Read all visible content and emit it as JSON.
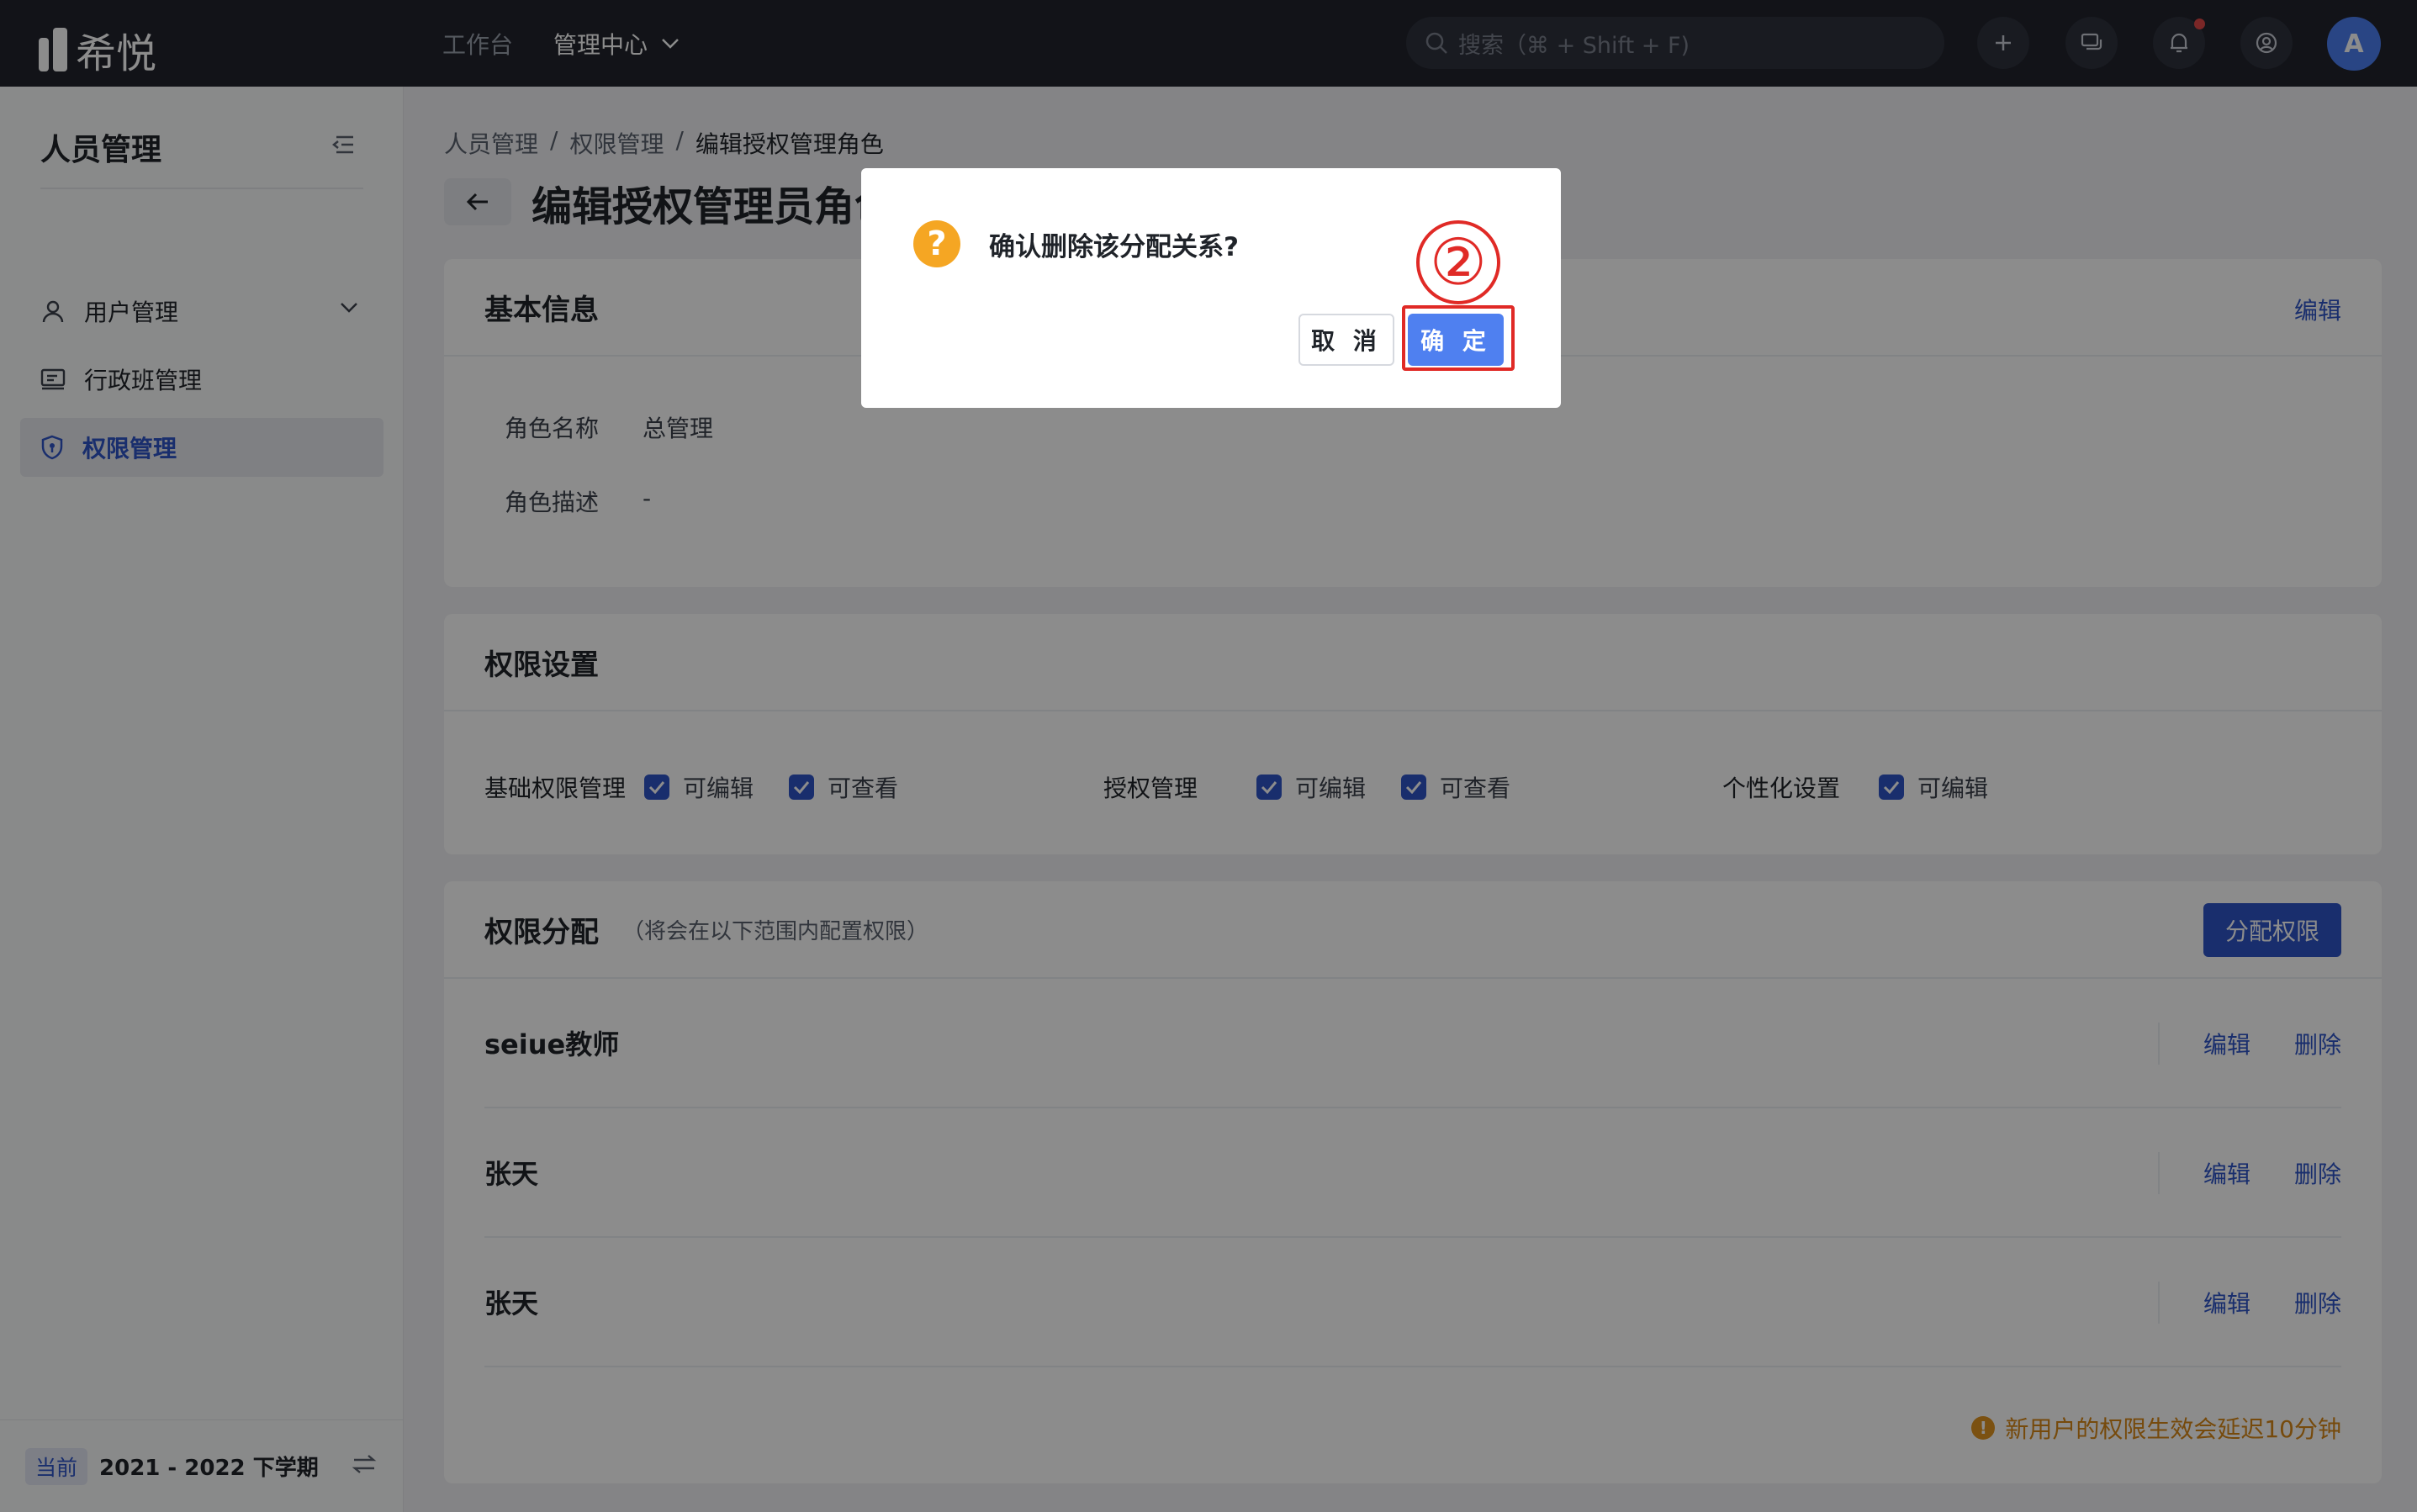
{
  "topbar": {
    "brand": "希悦",
    "nav": [
      {
        "label": "工作台"
      },
      {
        "label": "管理中心"
      }
    ],
    "search_placeholder": "搜索（⌘ + Shift + F)",
    "avatar_initial": "A"
  },
  "sidebar": {
    "title": "人员管理",
    "items": [
      {
        "label": "用户管理",
        "icon": "user-icon"
      },
      {
        "label": "行政班管理",
        "icon": "class-icon"
      },
      {
        "label": "权限管理",
        "icon": "shield-icon",
        "active": true
      }
    ],
    "footer": {
      "tag": "当前",
      "term": "2021 - 2022 下学期"
    }
  },
  "breadcrumb": [
    "人员管理",
    "权限管理",
    "编辑授权管理角色"
  ],
  "page_title": "编辑授权管理员角色",
  "basic_info": {
    "title": "基本信息",
    "edit_label": "编辑",
    "fields": [
      {
        "label": "角色名称",
        "value": "总管理"
      },
      {
        "label": "角色描述",
        "value": "-"
      }
    ]
  },
  "permission_settings": {
    "title": "权限设置",
    "groups": [
      {
        "name": "基础权限管理",
        "options": [
          "可编辑",
          "可查看"
        ]
      },
      {
        "name": "授权管理",
        "options": [
          "可编辑",
          "可查看"
        ]
      },
      {
        "name": "个性化设置",
        "options": [
          "可编辑"
        ]
      }
    ]
  },
  "permission_assign": {
    "title": "权限分配",
    "subtitle": "（将会在以下范围内配置权限）",
    "assign_button": "分配权限",
    "rows": [
      {
        "name": "seiue教师"
      },
      {
        "name": "张天"
      },
      {
        "name": "张天"
      }
    ],
    "edit_label": "编辑",
    "delete_label": "删除",
    "notice": "新用户的权限生效会延迟10分钟"
  },
  "dialog": {
    "message": "确认删除该分配关系?",
    "cancel": "取 消",
    "confirm": "确 定"
  },
  "annotation": {
    "step": "②",
    "color": "#e02a26"
  },
  "colors": {
    "primary": "#2f54c7",
    "topbar": "#21242d",
    "warning": "#d88716"
  }
}
